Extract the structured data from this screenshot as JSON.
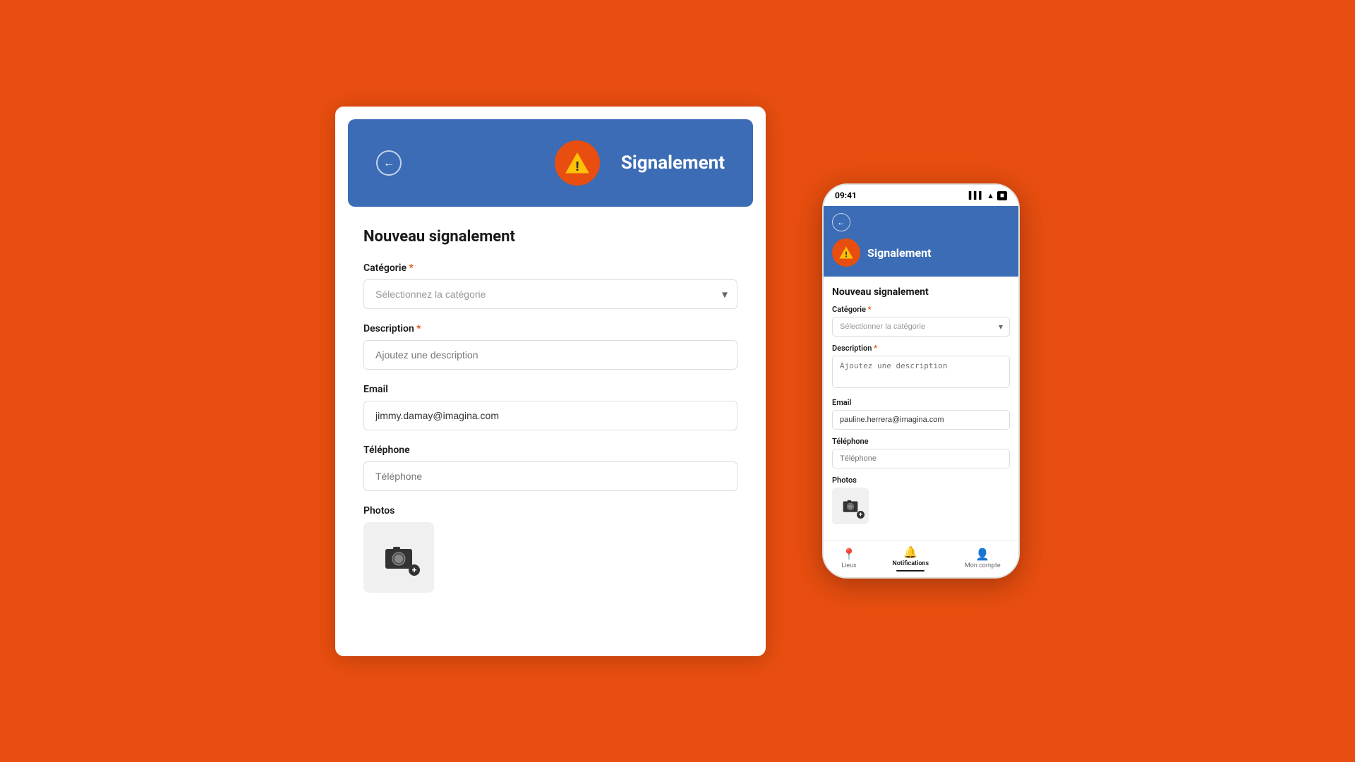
{
  "background_color": "#E84E0F",
  "desktop": {
    "header": {
      "title": "Signalement",
      "back_label": "←"
    },
    "form": {
      "title": "Nouveau signalement",
      "fields": {
        "category": {
          "label": "Catégorie",
          "required": true,
          "placeholder": "Sélectionnez la catégorie"
        },
        "description": {
          "label": "Description",
          "required": true,
          "placeholder": "Ajoutez une description"
        },
        "email": {
          "label": "Email",
          "required": false,
          "value": "jimmy.damay@imagina.com"
        },
        "telephone": {
          "label": "Téléphone",
          "required": false,
          "placeholder": "Téléphone"
        },
        "photos": {
          "label": "Photos"
        }
      }
    }
  },
  "mobile": {
    "status_bar": {
      "time": "09:41",
      "signal": "●●●",
      "wifi": "wifi",
      "battery": "battery"
    },
    "header": {
      "title": "Signalement",
      "back_label": "←"
    },
    "form": {
      "title": "Nouveau signalement",
      "fields": {
        "category": {
          "label": "Catégorie",
          "required": true,
          "placeholder": "Sélectionner la catégorie"
        },
        "description": {
          "label": "Description",
          "required": true,
          "placeholder": "Ajoutez une description"
        },
        "email": {
          "label": "Email",
          "value": "pauline.herrera@imagina.com"
        },
        "telephone": {
          "label": "Téléphone",
          "placeholder": "Téléphone"
        },
        "photos": {
          "label": "Photos"
        }
      }
    },
    "bottom_nav": {
      "items": [
        {
          "label": "Lieux",
          "icon": "📍",
          "active": false
        },
        {
          "label": "Notifications",
          "icon": "🔔",
          "active": true
        },
        {
          "label": "Mon compte",
          "icon": "👤",
          "active": false
        }
      ]
    }
  }
}
